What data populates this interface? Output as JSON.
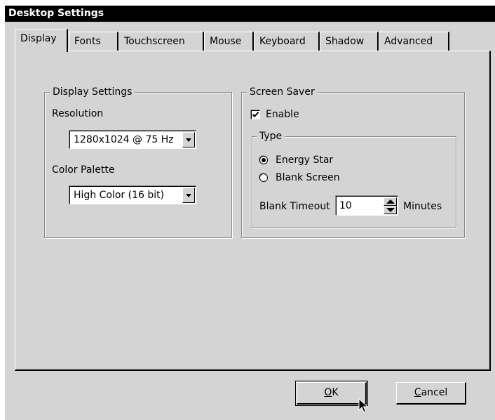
{
  "window": {
    "title": "Desktop Settings"
  },
  "tabs": [
    {
      "label": "Display",
      "active": true
    },
    {
      "label": "Fonts",
      "active": false
    },
    {
      "label": "Touchscreen",
      "active": false
    },
    {
      "label": "Mouse",
      "active": false
    },
    {
      "label": "Keyboard",
      "active": false
    },
    {
      "label": "Shadow",
      "active": false
    },
    {
      "label": "Advanced",
      "active": false
    }
  ],
  "display_settings": {
    "group_label": "Display Settings",
    "resolution_label": "Resolution",
    "resolution_value": "1280x1024 @ 75 Hz",
    "color_palette_label": "Color Palette",
    "color_palette_value": "High Color (16 bit)"
  },
  "screen_saver": {
    "group_label": "Screen Saver",
    "enable_label": "Enable",
    "enable_checked": true,
    "type_group_label": "Type",
    "options": [
      {
        "label": "Energy Star",
        "selected": true
      },
      {
        "label": "Blank Screen",
        "selected": false
      }
    ],
    "blank_timeout_label": "Blank Timeout",
    "blank_timeout_value": "10",
    "minutes_label": "Minutes"
  },
  "buttons": {
    "ok_mnemonic": "O",
    "ok_rest": "K",
    "cancel_mnemonic": "C",
    "cancel_rest": "ancel"
  }
}
